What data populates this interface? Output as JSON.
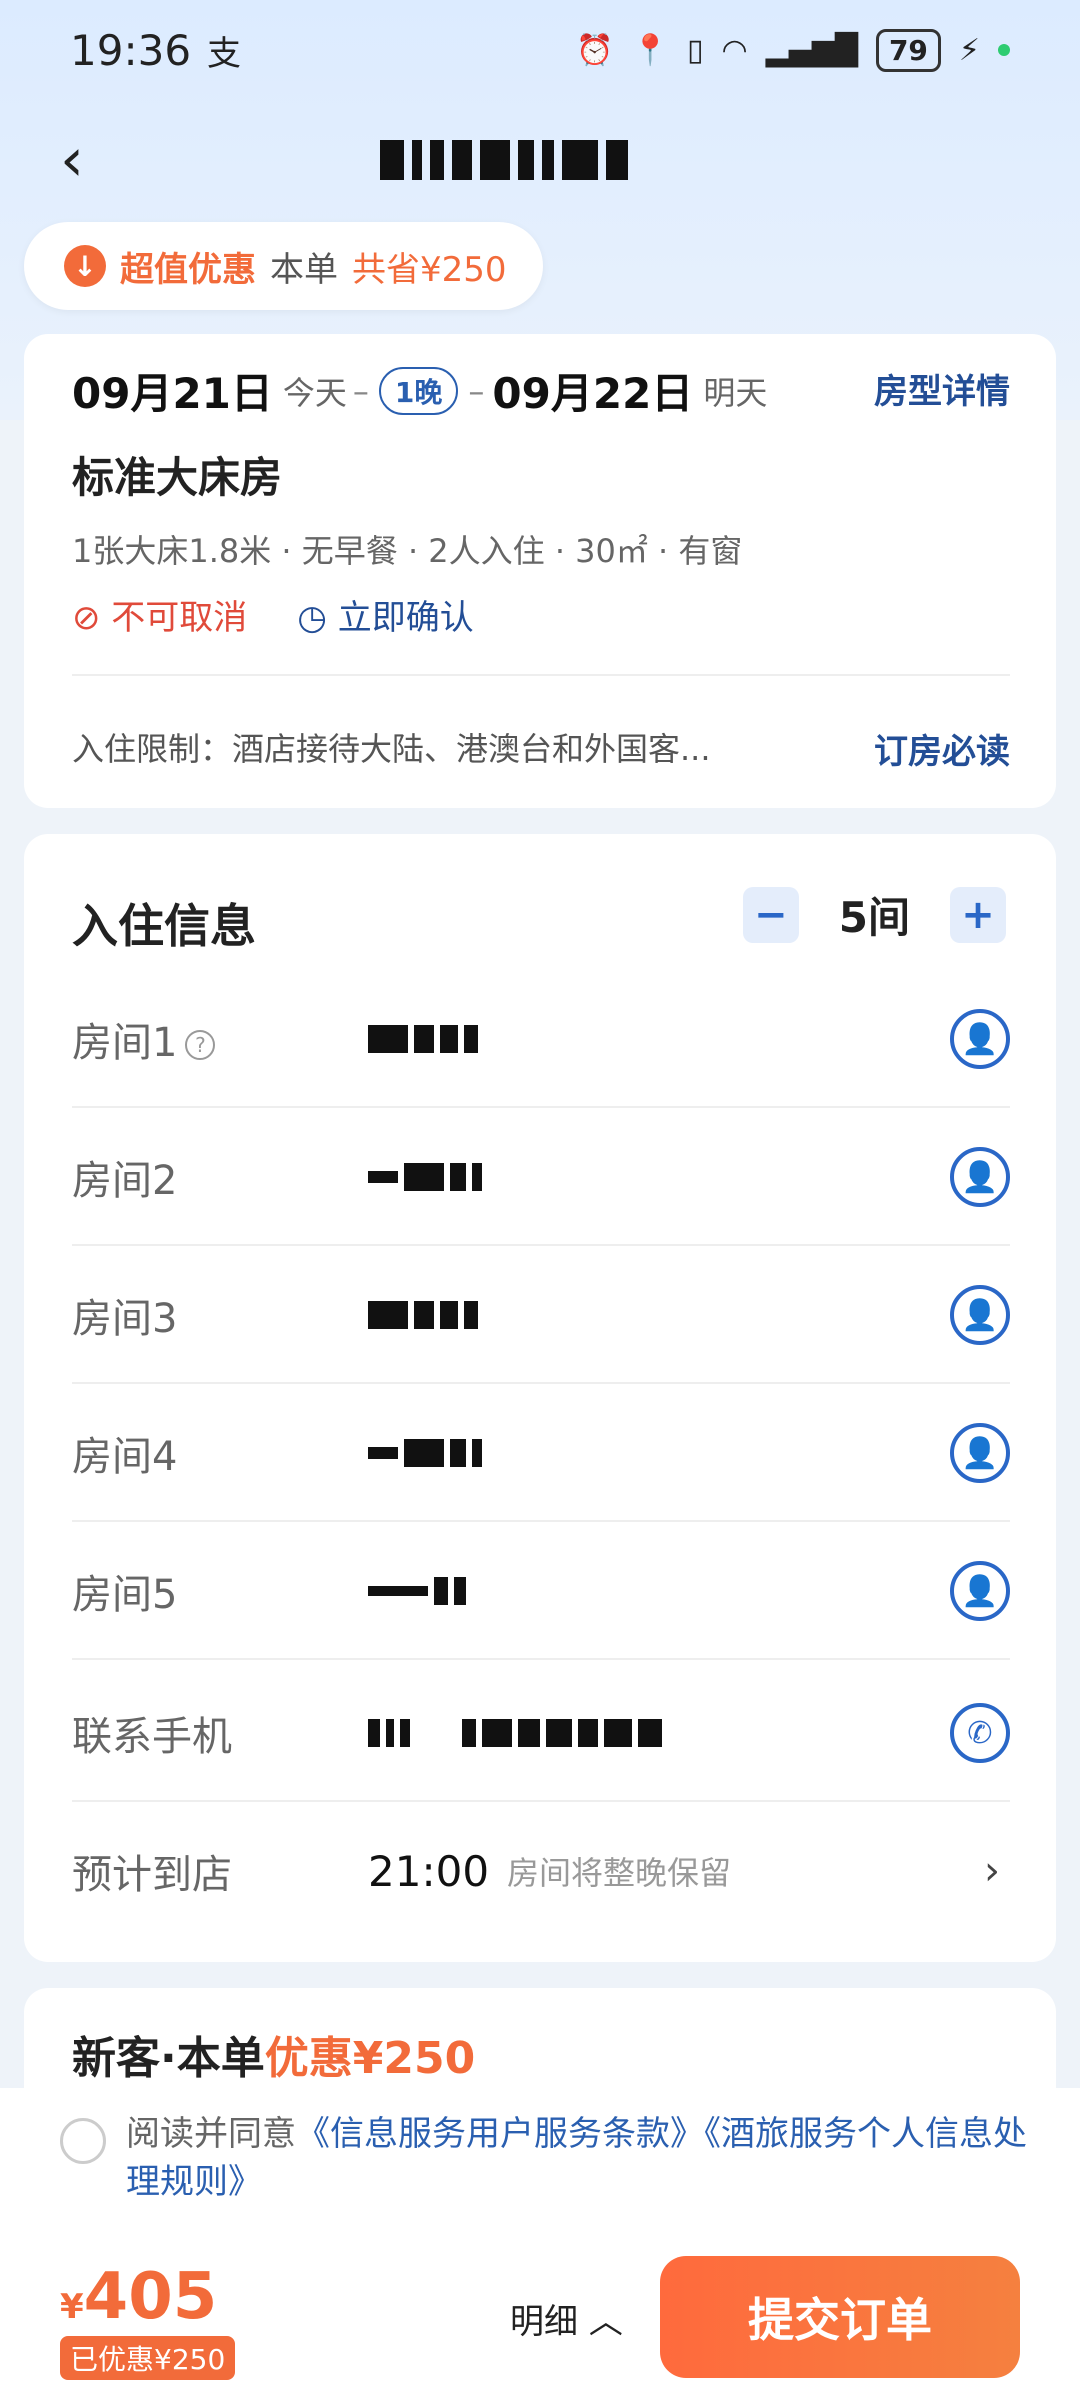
{
  "status_bar": {
    "time": "19:36",
    "pay_glyph": "支",
    "battery": "79"
  },
  "promo": {
    "label": "超值优惠",
    "text_pre": "本单",
    "text_hl": "共省¥250"
  },
  "booking": {
    "checkin_date": "09月21日",
    "checkin_day": "今天",
    "nights": "1晚",
    "checkout_date": "09月22日",
    "checkout_day": "明天",
    "room_detail_link": "房型详情",
    "room_name": "标准大床房",
    "room_attrs": "1张大床1.8米 · 无早餐 · 2人入住 · 30㎡ · 有窗",
    "tag_cancel": "不可取消",
    "tag_confirm": "立即确认",
    "restriction": "入住限制：酒店接待大陆、港澳台和外国客...",
    "must_read_link": "订房必读"
  },
  "guest_info": {
    "title": "入住信息",
    "room_count": "5间",
    "rooms": [
      {
        "label": "房间1"
      },
      {
        "label": "房间2"
      },
      {
        "label": "房间3"
      },
      {
        "label": "房间4"
      },
      {
        "label": "房间5"
      }
    ],
    "phone_label": "联系手机",
    "arrival_label": "预计到店",
    "arrival_time": "21:00",
    "arrival_note": "房间将整晚保留"
  },
  "discount": {
    "pre": "新客·本单",
    "hl": "优惠¥250"
  },
  "agreement": {
    "prefix": "阅读并同意",
    "link1": "《信息服务用户服务条款》",
    "link2": "《酒旅服务个人信息处理规则》"
  },
  "footer": {
    "currency": "¥",
    "price": "405",
    "saved": "已优惠¥250",
    "detail": "明细",
    "submit": "提交订单"
  }
}
